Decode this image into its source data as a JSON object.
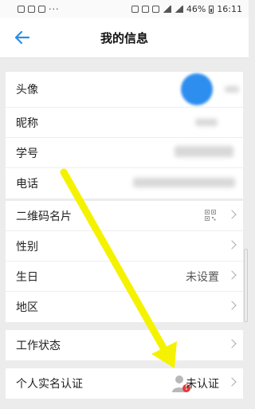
{
  "status": {
    "wifi": "wifi",
    "battery_pct": "46%",
    "time": "16:11",
    "dots": "···"
  },
  "header": {
    "title": "我的信息",
    "back_icon": "arrow-left-icon",
    "accent": "#2a8ee6"
  },
  "profile": [
    {
      "label": "头像",
      "kind": "avatar"
    },
    {
      "label": "昵称",
      "kind": "blurred"
    },
    {
      "label": "学号",
      "kind": "blurred"
    },
    {
      "label": "电话",
      "kind": "blurred"
    }
  ],
  "details": [
    {
      "label": "二维码名片",
      "icon": "qr-code-icon"
    },
    {
      "label": "性别"
    },
    {
      "label": "生日",
      "value": "未设置"
    },
    {
      "label": "地区"
    }
  ],
  "work": {
    "label": "工作状态"
  },
  "verify": {
    "label": "个人实名认证",
    "value": "未认证",
    "icon": "person-warning-icon",
    "warn_color": "#e23b3b"
  },
  "overlay": {
    "arrow_color": "#f5f200"
  }
}
